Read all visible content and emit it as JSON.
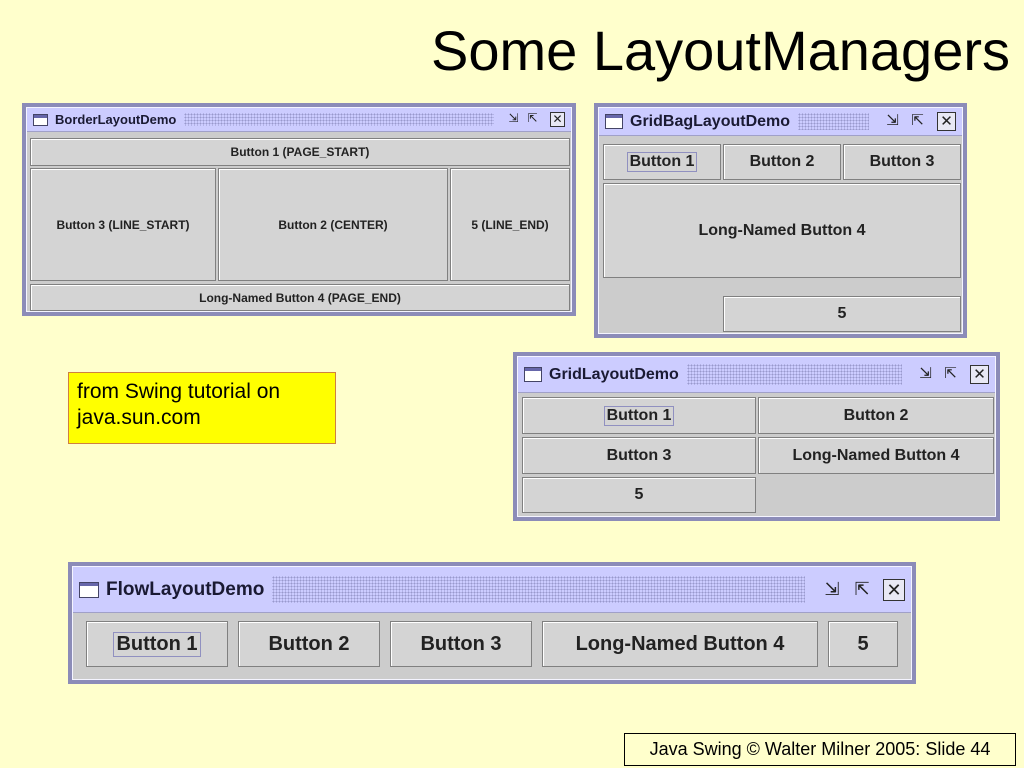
{
  "slide": {
    "title": "Some LayoutManagers",
    "note": [
      "from Swing tutorial on",
      "java.sun.com"
    ],
    "footer": "Java Swing © Walter Milner 2005: Slide 44"
  },
  "icons": {
    "app": "window-icon",
    "iconify": "minimize-icon",
    "maximize": "maximize-icon",
    "close": "close-icon"
  },
  "windows": {
    "border": {
      "title": "BorderLayoutDemo",
      "buttons": [
        "Button 1 (PAGE_START)",
        "Button 3 (LINE_START)",
        "Button 2 (CENTER)",
        "5 (LINE_END)",
        "Long-Named Button 4 (PAGE_END)"
      ]
    },
    "gridbag": {
      "title": "GridBagLayoutDemo",
      "buttons": [
        "Button 1",
        "Button 2",
        "Button 3",
        "Long-Named Button 4",
        "5"
      ]
    },
    "grid": {
      "title": "GridLayoutDemo",
      "buttons": [
        "Button 1",
        "Button 2",
        "Button 3",
        "Long-Named Button 4",
        "5"
      ]
    },
    "flow": {
      "title": "FlowLayoutDemo",
      "buttons": [
        "Button 1",
        "Button 2",
        "Button 3",
        "Long-Named Button 4",
        "5"
      ]
    }
  }
}
